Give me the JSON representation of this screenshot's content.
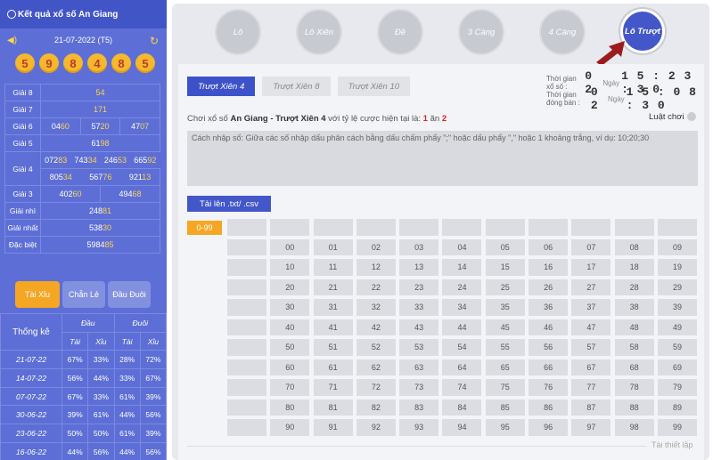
{
  "sidebar": {
    "title": "Kết quả xổ số An Giang",
    "date": "21-07-2022 (T5)",
    "balls": [
      "5",
      "9",
      "8",
      "4",
      "8",
      "5"
    ],
    "results": [
      {
        "label": "Giải 8",
        "cells": [
          {
            "pre": "",
            "hi": "54"
          }
        ]
      },
      {
        "label": "Giải 7",
        "cells": [
          {
            "pre": "",
            "hi": "171"
          }
        ]
      },
      {
        "label": "Giải 6",
        "cells": [
          {
            "pre": "04",
            "hi": "60"
          },
          {
            "pre": "57",
            "hi": "20"
          },
          {
            "pre": "47",
            "hi": "07"
          }
        ]
      },
      {
        "label": "Giải 5",
        "cells": [
          {
            "pre": "61",
            "hi": "98"
          }
        ]
      },
      {
        "label": "Giải 4",
        "row1": [
          {
            "pre": "072",
            "hi": "83"
          },
          {
            "pre": "743",
            "hi": "34"
          },
          {
            "pre": "246",
            "hi": "53"
          },
          {
            "pre": "665",
            "hi": "92"
          }
        ],
        "row2": [
          {
            "pre": "805",
            "hi": "34"
          },
          {
            "pre": "567",
            "hi": "76"
          },
          {
            "pre": "921",
            "hi": "13"
          }
        ]
      },
      {
        "label": "Giải 3",
        "cells": [
          {
            "pre": "402",
            "hi": "60"
          },
          {
            "pre": "494",
            "hi": "68"
          }
        ]
      },
      {
        "label": "Giải nhì",
        "cells": [
          {
            "pre": "248",
            "hi": "81"
          }
        ]
      },
      {
        "label": "Giải nhất",
        "cells": [
          {
            "pre": "538",
            "hi": "30"
          }
        ]
      },
      {
        "label": "Đặc biệt",
        "cells": [
          {
            "pre": "5984",
            "hi": "85"
          }
        ]
      }
    ],
    "tabs": [
      "Tài Xỉu",
      "Chẵn Lẻ",
      "Đầu Đuôi"
    ],
    "stats": {
      "title": "Thống kê",
      "dau": "Đầu",
      "duoi": "Đuôi",
      "tai": "Tài",
      "xiu": "Xỉu",
      "rows": [
        [
          "21-07-22",
          "67%",
          "33%",
          "28%",
          "72%"
        ],
        [
          "14-07-22",
          "56%",
          "44%",
          "33%",
          "67%"
        ],
        [
          "07-07-22",
          "67%",
          "33%",
          "61%",
          "39%"
        ],
        [
          "30-06-22",
          "39%",
          "61%",
          "44%",
          "56%"
        ],
        [
          "23-06-22",
          "50%",
          "50%",
          "61%",
          "39%"
        ],
        [
          "16-06-22",
          "44%",
          "56%",
          "44%",
          "56%"
        ],
        [
          "09-06-22",
          "50%",
          "50%",
          "50%",
          "50%"
        ]
      ]
    }
  },
  "nav": [
    "Lô",
    "Lô Xiên",
    "Đề",
    "3 Càng",
    "4 Càng",
    "Lô Trượt"
  ],
  "xtabs": [
    "Trượt Xiên 4",
    "Trượt Xiên 8",
    "Trượt Xiên 10"
  ],
  "time": {
    "l1": "Thời gian xổ số :",
    "d1": "0 2",
    "n1": "Ngày",
    "t1": "1 5 : 2 3 : 3 0",
    "l2": "Thời gian đóng bán :",
    "d2": "0 2",
    "n2": "Ngày",
    "t2": "1 5 : 0 8 : 3 0"
  },
  "desc": {
    "pre": "Chơi xổ số ",
    "bold": "An Giang - Trượt Xiên 4",
    "mid": " với tỷ lệ cược hiện tại là: ",
    "r1": "1",
    "an": " ăn ",
    "r2": "2"
  },
  "rules": "Luật chơi",
  "input_placeholder": "Cách nhập số: Giữa các số nhập dấu phân cách bằng dấu chấm phẩy \";\" hoặc dấu phẩy \",\" hoặc 1 khoảng trắng, ví dụ: 10;20;30",
  "upload": "Tải lên .txt/ .csv",
  "range": "0-99",
  "reset": "Tài thiết lập",
  "colors": {
    "accent": "#4457c9",
    "sidebar": "#5d6fd6",
    "orange": "#f5a623",
    "arrow": "#9b1c1c"
  }
}
